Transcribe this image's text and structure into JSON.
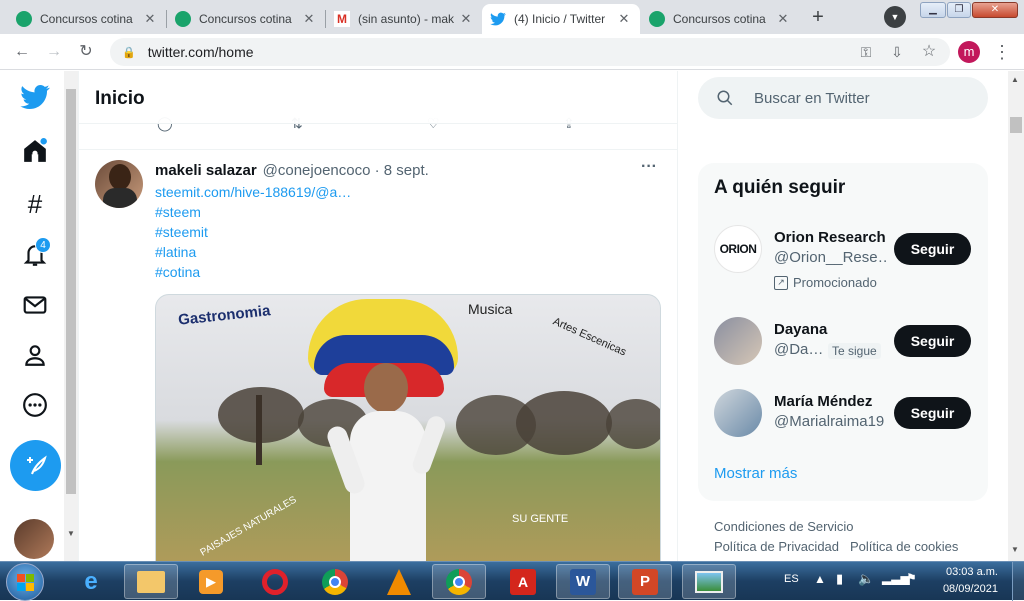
{
  "browser": {
    "tabs": [
      {
        "title": "Concursos cotina"
      },
      {
        "title": "Concursos cotina"
      },
      {
        "title": "(sin asunto) - mak"
      },
      {
        "title": "(4) Inicio / Twitter"
      },
      {
        "title": "Concursos cotina"
      }
    ],
    "url": "twitter.com/home",
    "profile_initial": "m"
  },
  "nav": {
    "notifications_badge": "4"
  },
  "main": {
    "title": "Inicio"
  },
  "tweet": {
    "name": "makeli salazar",
    "handle_date": "@conejoencoco · 8 sept.",
    "link": "steemit.com/hive-188619/@a…",
    "hashtags": [
      "#steem",
      "#steemit",
      "#latina",
      "#cotina"
    ],
    "menu": "···",
    "image_text": {
      "gastronomia": "Gastronomia",
      "musica": "Musica",
      "artes": "Artes Escenicas",
      "paisajes": "PAISAJES NATURALES",
      "gente": "SU GENTE"
    }
  },
  "right": {
    "search_placeholder": "Buscar en Twitter",
    "peek_text": "Mostrar más",
    "follow_title": "A quién seguir",
    "suggestions": [
      {
        "name": "Orion Research",
        "handle": "@Orion__Rese…",
        "promoted": "Promocionado",
        "button": "Seguir",
        "logo": "ORION"
      },
      {
        "name": "Dayana",
        "handle": "@Da…",
        "follows_you": "Te sigue",
        "button": "Seguir"
      },
      {
        "name": "María Méndez",
        "handle": "@Marialraima19",
        "button": "Seguir"
      }
    ],
    "show_more": "Mostrar más",
    "footer": [
      "Condiciones de Servicio",
      "Política de Privacidad",
      "Política de cookies"
    ]
  },
  "taskbar": {
    "lang": "ES",
    "time": "03:03 a.m.",
    "date": "08/09/2021"
  },
  "colors": {
    "twitter_blue": "#1d9bf0",
    "dark": "#0f1419"
  }
}
